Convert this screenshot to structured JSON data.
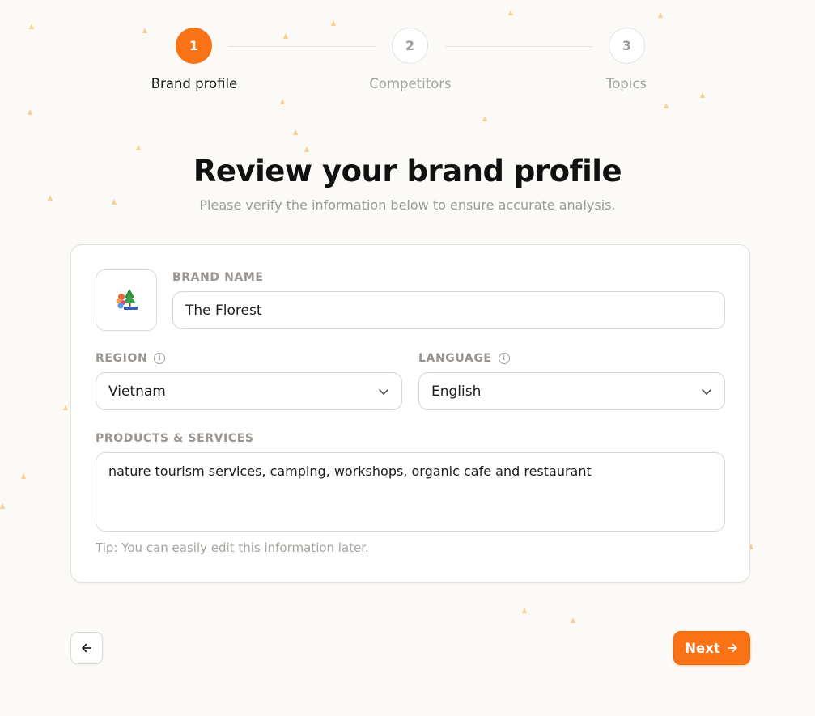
{
  "stepper": {
    "steps": [
      {
        "number": "1",
        "label": "Brand profile",
        "state": "active"
      },
      {
        "number": "2",
        "label": "Competitors",
        "state": "inactive"
      },
      {
        "number": "3",
        "label": "Topics",
        "state": "inactive"
      }
    ]
  },
  "header": {
    "title": "Review your brand profile",
    "subtitle": "Please verify the information below to ensure accurate analysis."
  },
  "form": {
    "brand_name_label": "BRAND NAME",
    "brand_name_value": "The Florest",
    "region_label": "REGION",
    "region_value": "Vietnam",
    "language_label": "LANGUAGE",
    "language_value": "English",
    "products_label": "PRODUCTS & SERVICES",
    "products_value": "nature tourism services, camping, workshops, organic cafe and restaurant",
    "tip": "Tip: You can easily edit this information later."
  },
  "footer": {
    "next_label": "Next"
  },
  "colors": {
    "accent": "#f97316",
    "background": "#fcfaf6",
    "dots": "#f8cf8f"
  },
  "icons": {
    "back": "arrow-left-icon",
    "next": "arrow-right-icon",
    "dropdown": "chevron-down-icon",
    "info": "info-icon"
  }
}
